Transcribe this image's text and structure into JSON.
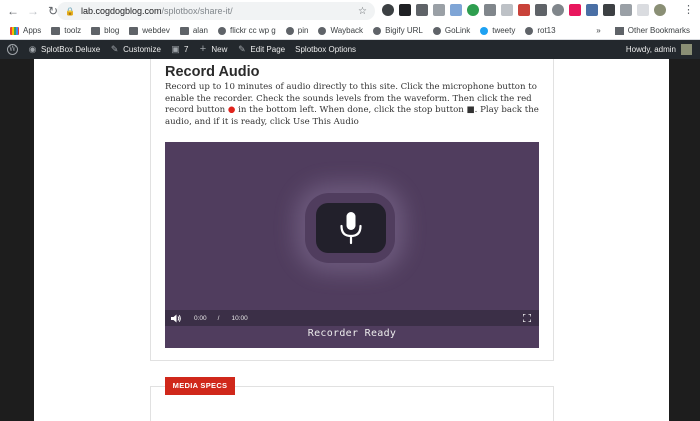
{
  "browser": {
    "url_host": "lab.cogdogblog.com",
    "url_path": "/splotbox/share-it/",
    "bookmarks": [
      {
        "label": "Apps",
        "icon": "apps-icon"
      },
      {
        "label": "toolz",
        "icon": "folder-icon"
      },
      {
        "label": "blog",
        "icon": "folder-icon"
      },
      {
        "label": "webdev",
        "icon": "folder-icon"
      },
      {
        "label": "alan",
        "icon": "folder-icon"
      },
      {
        "label": "flickr cc wp g",
        "icon": "globe-icon"
      },
      {
        "label": "pin",
        "icon": "globe-icon"
      },
      {
        "label": "Wayback",
        "icon": "globe-icon"
      },
      {
        "label": "Bigify URL",
        "icon": "globe-icon"
      },
      {
        "label": "GoLink",
        "icon": "globe-icon"
      },
      {
        "label": "tweety",
        "icon": "twitter-icon"
      },
      {
        "label": "rot13",
        "icon": "globe-icon"
      }
    ],
    "overflow_label": "»",
    "other_bookmarks": "Other Bookmarks"
  },
  "adminbar": {
    "site_name": "SplotBox Deluxe",
    "customize": "Customize",
    "comments_count": "7",
    "new_label": "New",
    "edit_page": "Edit Page",
    "splotbox_options": "Splotbox Options",
    "howdy": "Howdy, admin"
  },
  "content": {
    "title": "Record Audio",
    "desc_part1": "Record up to 10 minutes of audio directly to this site. Click the microphone button to enable the recorder. Check the sounds levels from the waveform. Then click the red record button ",
    "record_symbol": "●",
    "desc_part2": " in the bottom left. When done, click the stop button ",
    "stop_symbol": "■",
    "desc_part3": ". Play back the audio, and if it is ready, click Use This Audio"
  },
  "player": {
    "current_time": "0:00",
    "separator": "/",
    "duration": "10:00",
    "status": "Recorder Ready"
  },
  "specs": {
    "tag": "MEDIA SPECS"
  },
  "colors": {
    "player_bg": "#503d5e",
    "accent_red": "#d0281b",
    "adminbar_bg": "#23282d"
  }
}
